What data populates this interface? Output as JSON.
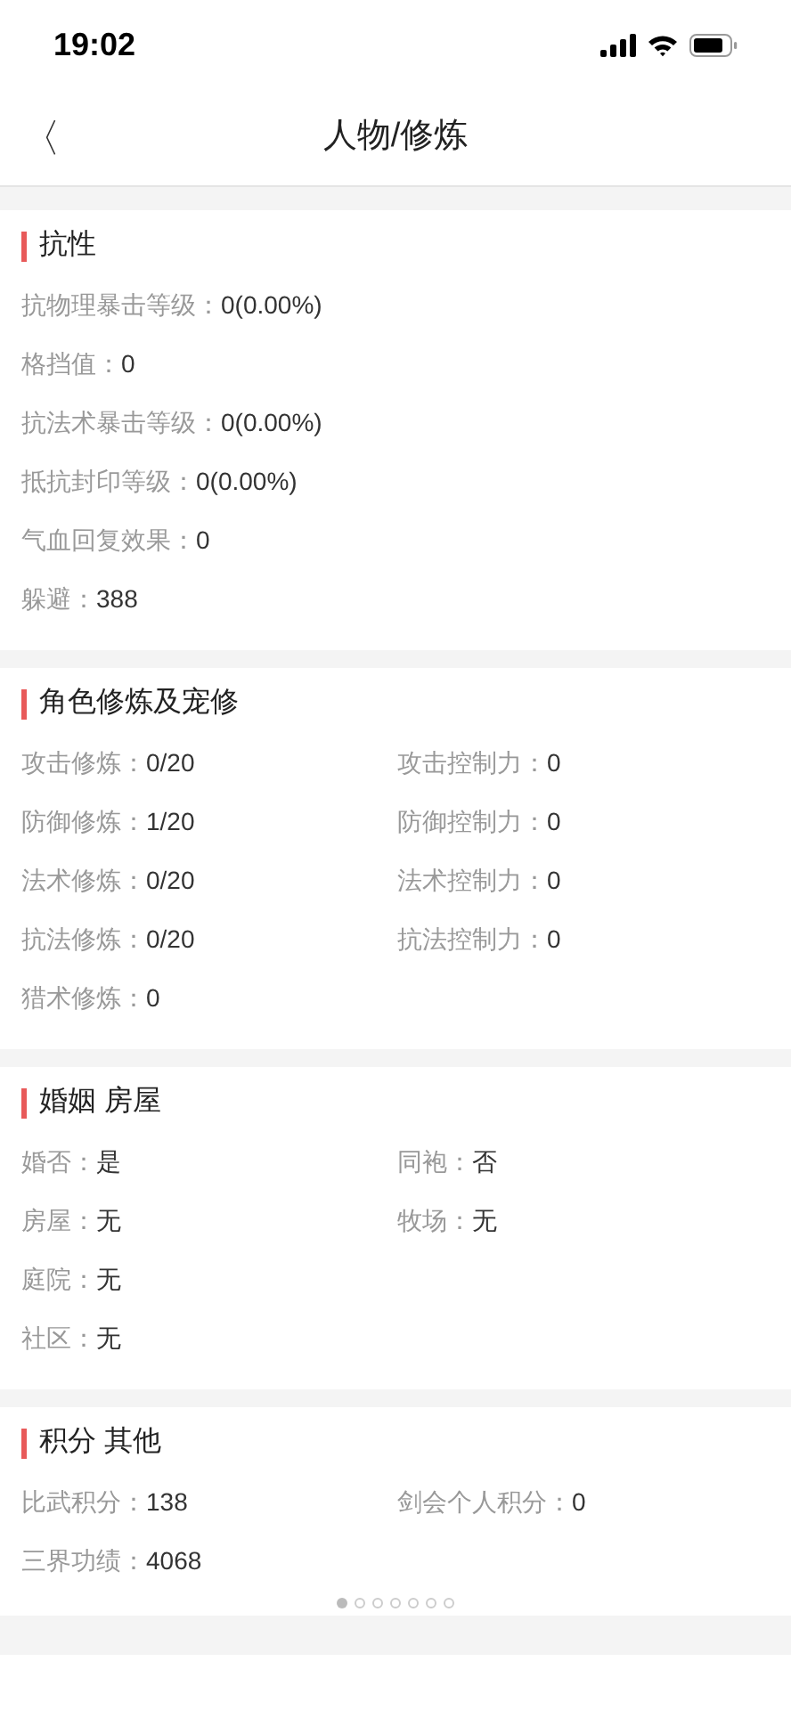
{
  "status_bar": {
    "time": "19:02"
  },
  "nav": {
    "back": "〈",
    "title": "人物/修炼"
  },
  "sections": [
    {
      "title": "抗性",
      "rows": [
        {
          "left": {
            "label": "抗物理暴击等级：",
            "value": "0(0.00%)"
          }
        },
        {
          "left": {
            "label": "格挡值：",
            "value": "0"
          }
        },
        {
          "left": {
            "label": "抗法术暴击等级：",
            "value": "0(0.00%)"
          }
        },
        {
          "left": {
            "label": "抵抗封印等级：",
            "value": "0(0.00%)"
          }
        },
        {
          "left": {
            "label": "气血回复效果：",
            "value": "0"
          }
        },
        {
          "left": {
            "label": "躲避：",
            "value": "388"
          }
        }
      ]
    },
    {
      "title": "角色修炼及宠修",
      "rows": [
        {
          "left": {
            "label": "攻击修炼：",
            "value": "0/20"
          },
          "right": {
            "label": "攻击控制力：",
            "value": "0"
          }
        },
        {
          "left": {
            "label": "防御修炼：",
            "value": "1/20"
          },
          "right": {
            "label": "防御控制力：",
            "value": "0"
          }
        },
        {
          "left": {
            "label": "法术修炼：",
            "value": "0/20"
          },
          "right": {
            "label": "法术控制力：",
            "value": "0"
          }
        },
        {
          "left": {
            "label": "抗法修炼：",
            "value": "0/20"
          },
          "right": {
            "label": "抗法控制力：",
            "value": "0"
          }
        },
        {
          "left": {
            "label": "猎术修炼：",
            "value": "0"
          }
        }
      ]
    },
    {
      "title": "婚姻 房屋",
      "rows": [
        {
          "left": {
            "label": "婚否：",
            "value": "是"
          },
          "right": {
            "label": "同袍：",
            "value": "否"
          }
        },
        {
          "left": {
            "label": "房屋：",
            "value": "无"
          },
          "right": {
            "label": "牧场：",
            "value": "无"
          }
        },
        {
          "left": {
            "label": "庭院：",
            "value": "无"
          }
        },
        {
          "left": {
            "label": "社区：",
            "value": "无"
          }
        }
      ]
    },
    {
      "title": "积分 其他",
      "rows": [
        {
          "left": {
            "label": "比武积分：",
            "value": "138"
          },
          "right": {
            "label": "剑会个人积分：",
            "value": "0"
          }
        },
        {
          "left": {
            "label": "三界功绩：",
            "value": "4068"
          }
        }
      ]
    }
  ],
  "page_dots": [
    {
      "selected": true
    },
    {
      "selected": false
    },
    {
      "selected": false
    },
    {
      "selected": false
    },
    {
      "selected": false
    },
    {
      "selected": false
    },
    {
      "selected": false
    }
  ]
}
